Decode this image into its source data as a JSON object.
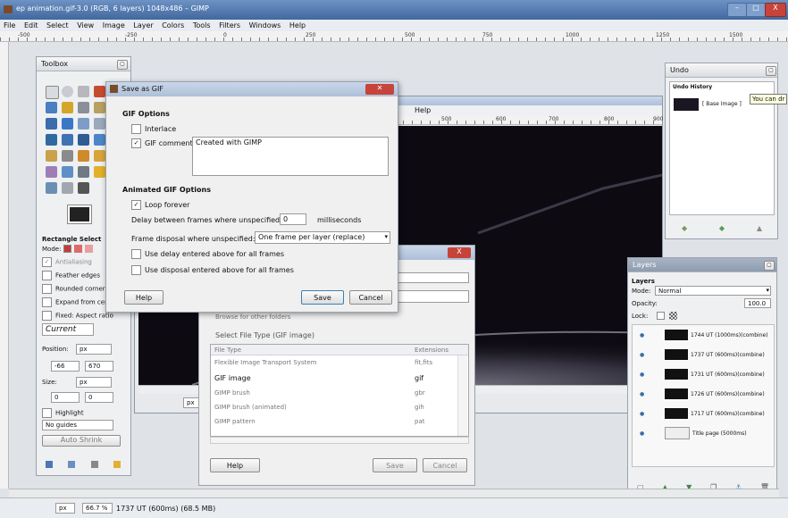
{
  "window": {
    "title": "ep animation.gif-3.0 (RGB, 6 layers) 1048x486 – GIMP",
    "min": "–",
    "max": "□",
    "close": "X"
  },
  "menu": [
    "File",
    "Edit",
    "Select",
    "View",
    "Image",
    "Layer",
    "Colors",
    "Tools",
    "Filters",
    "Windows",
    "Help"
  ],
  "ruler_top": [
    "-500",
    "-250",
    "0",
    "250",
    "500",
    "750",
    "1000",
    "1250",
    "1500"
  ],
  "ruler_inner": [
    "500",
    "600",
    "700",
    "800",
    "900"
  ],
  "toolbox": {
    "title": "Toolbox",
    "options_title": "Rectangle Select",
    "mode_label": "Mode:",
    "antialiasing": "Antialiasing",
    "feather": "Feather edges",
    "rounded": "Rounded corners",
    "expand": "Expand from center",
    "fixed": "Fixed: Aspect ratio",
    "current": "Current",
    "position_label": "Position:",
    "unit": "px",
    "pos_x": "-66",
    "pos_y": "670",
    "size_label": "Size:",
    "size_unit": "px",
    "size_w": "0",
    "size_h": "0",
    "highlight": "Highlight",
    "guides": "No guides",
    "auto_shrink": "Auto Shrink"
  },
  "gif_dialog": {
    "title": "Save as GIF",
    "section1": "GIF Options",
    "interlace": "Interlace",
    "comment_label": "GIF comment:",
    "comment_value": "Created with GIMP",
    "section2": "Animated GIF Options",
    "loop": "Loop forever",
    "delay_label": "Delay between frames where unspecified:",
    "delay_value": "0",
    "delay_unit": "milliseconds",
    "disposal_label": "Frame disposal where unspecified:",
    "disposal_value": "One frame per layer (replace)",
    "use_delay": "Use delay entered above for all frames",
    "use_disposal": "Use disposal entered above for all frames",
    "help": "Help",
    "save": "Save",
    "cancel": "Cancel"
  },
  "image_window": {
    "help_menu": "Help"
  },
  "export_dialog": {
    "close": "X",
    "browse": "Browse for other folders",
    "select_type": "Select File Type (GIF image)",
    "col_type": "File Type",
    "col_ext": "Extensions",
    "rows": [
      {
        "type": "Flexible Image Transport System",
        "ext": "fit,fits"
      },
      {
        "type": "GIF image",
        "ext": "gif"
      },
      {
        "type": "GIMP brush",
        "ext": "gbr"
      },
      {
        "type": "GIMP brush (animated)",
        "ext": "gih"
      },
      {
        "type": "GIMP pattern",
        "ext": "pat"
      }
    ],
    "help": "Help",
    "save": "Save",
    "cancel": "Cancel"
  },
  "undo": {
    "title": "Undo",
    "header": "Undo History",
    "item": "[ Base Image ]",
    "tooltip": "You can dr"
  },
  "layers": {
    "title": "Layers",
    "header": "Layers",
    "mode_label": "Mode:",
    "mode_value": "Normal",
    "opacity_label": "Opacity:",
    "opacity_value": "100.0",
    "lock_label": "Lock:",
    "items": [
      "1744 UT (1000ms)(combine)",
      "1737 UT (600ms)(combine)",
      "1731 UT (600ms)(combine)",
      "1726 UT (600ms)(combine)",
      "1717 UT (600ms)(combine)",
      "Title page (5000ms)"
    ]
  },
  "status": {
    "unit": "px",
    "zoom": "66.7 %",
    "info": "1737 UT (600ms) (68.5 MB)"
  },
  "colors": {
    "accent": "#3a62a0",
    "canvas": "#0d0a12",
    "dialog_close": "#c6443a"
  }
}
